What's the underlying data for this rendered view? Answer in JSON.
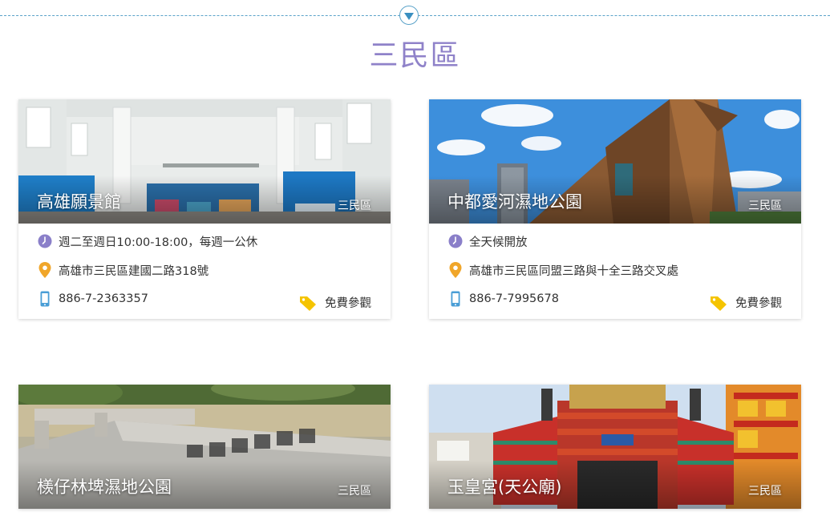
{
  "section": {
    "title": "三民區"
  },
  "cards": [
    {
      "title": "高雄願景館",
      "district": "三民區",
      "hours": "週二至週日10:00-18:00，每週一公休",
      "address": "高雄市三民區建國二路318號",
      "phone": "886-7-2363357",
      "fee": "免費參觀"
    },
    {
      "title": "中都愛河濕地公園",
      "district": "三民區",
      "hours": "全天候開放",
      "address": "高雄市三民區同盟三路與十全三路交叉處",
      "phone": "886-7-7995678",
      "fee": "免費參觀"
    },
    {
      "title": "檨仔林埤濕地公園",
      "district": "三民區"
    },
    {
      "title": "玉皇宮(天公廟)",
      "district": "三民區"
    }
  ],
  "icons": {
    "divider": "chevron-down-icon",
    "hours": "clock-icon",
    "address": "location-pin-icon",
    "phone": "mobile-phone-icon",
    "fee": "price-tag-icon"
  },
  "colors": {
    "title": "#8f82c9",
    "clock": "#8a7fc9",
    "pin": "#f0a62a",
    "phone": "#4a9ed6",
    "tag": "#f5c400",
    "divider": "#5ba3c9"
  }
}
